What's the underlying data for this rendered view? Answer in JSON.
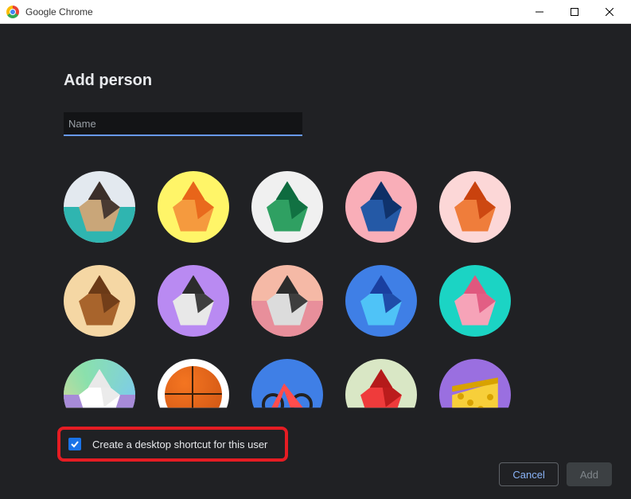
{
  "window": {
    "title": "Google Chrome"
  },
  "dialog": {
    "heading": "Add person",
    "name_placeholder": "Name",
    "name_value": "",
    "shortcut_checkbox_label": "Create a desktop shortcut for this user",
    "shortcut_checked": true,
    "cancel_label": "Cancel",
    "add_label": "Add"
  },
  "avatars": [
    {
      "name": "origami-cat",
      "bg": "#e3e9ef",
      "half": "#2fb5b0",
      "c1": "#3b2f2a",
      "c2": "#c9a679"
    },
    {
      "name": "origami-fox",
      "bg": "#fff568",
      "half": "#fff568",
      "c1": "#e8651a",
      "c2": "#f59a3e"
    },
    {
      "name": "origami-dragon",
      "bg": "#f0f0f0",
      "half": "#f0f0f0",
      "c1": "#0e6b3f",
      "c2": "#2fa062"
    },
    {
      "name": "origami-elephant",
      "bg": "#f9aeb8",
      "half": "#f9aeb8",
      "c1": "#0e2f66",
      "c2": "#2459a6"
    },
    {
      "name": "origami-squirrel",
      "bg": "#fcd7d7",
      "half": "#fcd7d7",
      "c1": "#c9420e",
      "c2": "#ef7d3b"
    },
    {
      "name": "origami-monkey",
      "bg": "#f5d7a4",
      "half": "#f5d7a4",
      "c1": "#6b3a17",
      "c2": "#a8642c"
    },
    {
      "name": "origami-panda",
      "bg": "#b98af2",
      "half": "#b98af2",
      "c1": "#2c2c2c",
      "c2": "#e8e8e8"
    },
    {
      "name": "origami-penguin",
      "bg": "#f5b9a6",
      "half": "#e88f9b",
      "c1": "#2c2c2c",
      "c2": "#dcdcdc"
    },
    {
      "name": "origami-butterfly",
      "bg": "#3f7fe6",
      "half": "#3f7fe6",
      "c1": "#1a3fa0",
      "c2": "#4fc3f7"
    },
    {
      "name": "origami-rabbit",
      "bg": "#1bd4c4",
      "half": "#1bd4c4",
      "c1": "#e0577e",
      "c2": "#f6a3b8"
    },
    {
      "name": "origami-unicorn",
      "bg": "#c9e2f5",
      "half": "#a78bd8",
      "c1": "#e9e9e9",
      "c2": "#ffffff"
    },
    {
      "name": "origami-basketball",
      "bg": "#ffffff",
      "half": "#ffffff",
      "c1": "#cc5212",
      "c2": "#f47521"
    },
    {
      "name": "origami-bicycle",
      "bg": "#3f7fe6",
      "half": "#3f7fe6",
      "c1": "#f47521",
      "c2": "#ff4d4d"
    },
    {
      "name": "origami-bird",
      "bg": "#d9e7c5",
      "half": "#d9e7c5",
      "c1": "#b51a1a",
      "c2": "#ef3b3b"
    },
    {
      "name": "origami-cheese",
      "bg": "#9a6fe0",
      "half": "#9a6fe0",
      "c1": "#d8a200",
      "c2": "#f7cf3a"
    }
  ]
}
